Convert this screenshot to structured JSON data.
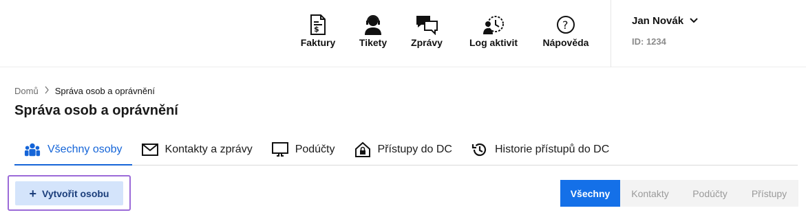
{
  "header": {
    "nav": [
      {
        "label": "Faktury",
        "icon": "invoice-icon"
      },
      {
        "label": "Tikety",
        "icon": "support-agent-icon"
      },
      {
        "label": "Zprávy",
        "icon": "chat-bubbles-icon"
      },
      {
        "label": "Log aktivit",
        "icon": "activity-log-icon"
      },
      {
        "label": "Nápověda",
        "icon": "help-icon"
      }
    ],
    "user": {
      "name": "Jan Novák",
      "id": "ID: 1234"
    }
  },
  "breadcrumb": {
    "home": "Domů",
    "current": "Správa osob a oprávnění"
  },
  "page_title": "Správa osob a oprávnění",
  "tabs": [
    {
      "label": "Všechny osoby",
      "icon": "people-icon",
      "active": true
    },
    {
      "label": "Kontakty a zprávy",
      "icon": "envelope-icon",
      "active": false
    },
    {
      "label": "Podúčty",
      "icon": "monitor-icon",
      "active": false
    },
    {
      "label": "Přístupy do DC",
      "icon": "house-lock-icon",
      "active": false
    },
    {
      "label": "Historie přístupů do DC",
      "icon": "history-icon",
      "active": false
    }
  ],
  "actions": {
    "create_label": "Vytvořit osobu"
  },
  "filters": [
    {
      "label": "Všechny",
      "active": true
    },
    {
      "label": "Kontakty",
      "active": false
    },
    {
      "label": "Podúčty",
      "active": false
    },
    {
      "label": "Přístupy",
      "active": false
    }
  ],
  "colors": {
    "accent": "#1470e8",
    "tab_active": "#1565d8",
    "create_bg": "#d4e4fb",
    "highlight_border": "#9b6ad8"
  }
}
